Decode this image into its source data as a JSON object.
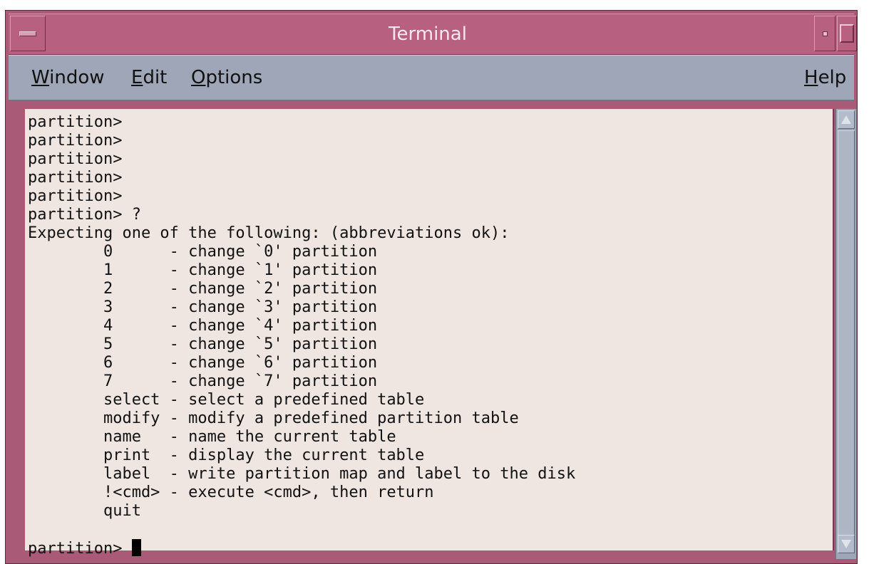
{
  "window": {
    "title": "Terminal"
  },
  "menubar": {
    "items": [
      {
        "label_ul": "W",
        "label_rest": "indow"
      },
      {
        "label_ul": "E",
        "label_rest": "dit"
      },
      {
        "label_ul": "O",
        "label_rest": "ptions"
      }
    ],
    "help": {
      "label_ul": "H",
      "label_rest": "elp"
    }
  },
  "terminal": {
    "lines": [
      "partition>",
      "partition>",
      "partition>",
      "partition>",
      "partition>",
      "partition> ?",
      "Expecting one of the following: (abbreviations ok):",
      "        0      - change `0' partition",
      "        1      - change `1' partition",
      "        2      - change `2' partition",
      "        3      - change `3' partition",
      "        4      - change `4' partition",
      "        5      - change `5' partition",
      "        6      - change `6' partition",
      "        7      - change `7' partition",
      "        select - select a predefined table",
      "        modify - modify a predefined partition table",
      "        name   - name the current table",
      "        print  - display the current table",
      "        label  - write partition map and label to the disk",
      "        !<cmd> - execute <cmd>, then return",
      "        quit",
      ""
    ],
    "prompt": "partition> "
  },
  "icons": {
    "window_menu": "window-menu-icon",
    "minimize": "minimize-icon",
    "maximize": "maximize-icon",
    "scroll_up": "arrow-up-icon",
    "scroll_down": "arrow-down-icon"
  },
  "colors": {
    "title_bar": "#b7607f",
    "menu_bar": "#9ea6b8",
    "terminal_bg": "#efe6e2"
  }
}
